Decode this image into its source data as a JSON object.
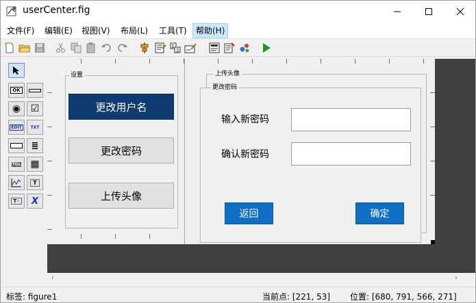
{
  "window": {
    "title": "userCenter.fig",
    "controls": {
      "minimize": "—",
      "maximize": "☐",
      "close": "✕"
    }
  },
  "menubar": {
    "items": [
      {
        "label": "文件(F)"
      },
      {
        "label": "编辑(E)"
      },
      {
        "label": "视图(V)"
      },
      {
        "label": "布局(L)"
      },
      {
        "label": "工具(T)"
      },
      {
        "label": "帮助(H)",
        "active": true
      }
    ]
  },
  "toolbar": {
    "icons": [
      "new-file-icon",
      "open-folder-icon",
      "save-icon",
      "cut-icon",
      "copy-icon",
      "paste-icon",
      "undo-icon",
      "redo-icon",
      "align-icon",
      "menu-editor-icon",
      "tab-order-icon",
      "toolbar-editor-icon",
      "editor-icon",
      "property-inspector-icon",
      "object-browser-icon",
      "run-icon"
    ]
  },
  "palette": {
    "items": [
      {
        "name": "select-arrow",
        "glyph": "↖"
      },
      {
        "name": "pushbutton",
        "glyph": "OK"
      },
      {
        "name": "slider",
        "glyph": "▭"
      },
      {
        "name": "radio-button",
        "glyph": "◉"
      },
      {
        "name": "checkbox",
        "glyph": "☑"
      },
      {
        "name": "edit-text",
        "glyph": "EDIT"
      },
      {
        "name": "static-text",
        "glyph": "TXT"
      },
      {
        "name": "popup-menu",
        "glyph": "▭▾"
      },
      {
        "name": "listbox",
        "glyph": "≣"
      },
      {
        "name": "toggle-button",
        "glyph": "TGL"
      },
      {
        "name": "table",
        "glyph": "▦"
      },
      {
        "name": "axes",
        "glyph": "📈"
      },
      {
        "name": "panel",
        "glyph": "T"
      },
      {
        "name": "button-group",
        "glyph": "T◦"
      },
      {
        "name": "activex",
        "glyph": "X"
      }
    ]
  },
  "figure": {
    "settings_panel": {
      "title": "设置",
      "buttons": [
        {
          "label": "更改用户名",
          "primary": true
        },
        {
          "label": "更改密码"
        },
        {
          "label": "上传头像"
        }
      ]
    },
    "upload_panel": {
      "title": "上传头像"
    },
    "password_panel": {
      "title": "更改密码",
      "new_password_label": "输入新密码",
      "confirm_password_label": "确认新密码",
      "new_password_value": "",
      "confirm_password_value": "",
      "back_label": "返回",
      "confirm_label": "确定"
    }
  },
  "scrollbar": {
    "left_arrow": "‹",
    "right_arrow": "›"
  },
  "statusbar": {
    "tag": "标签: figure1",
    "current_point": "当前点:   [221, 53]",
    "position": "位置: [680, 791, 566, 271]"
  },
  "colors": {
    "primary_button": "#0f3c70",
    "blue_button": "#0e6fc3",
    "canvas_bg": "#404040",
    "run_green": "#1a9a1a"
  }
}
